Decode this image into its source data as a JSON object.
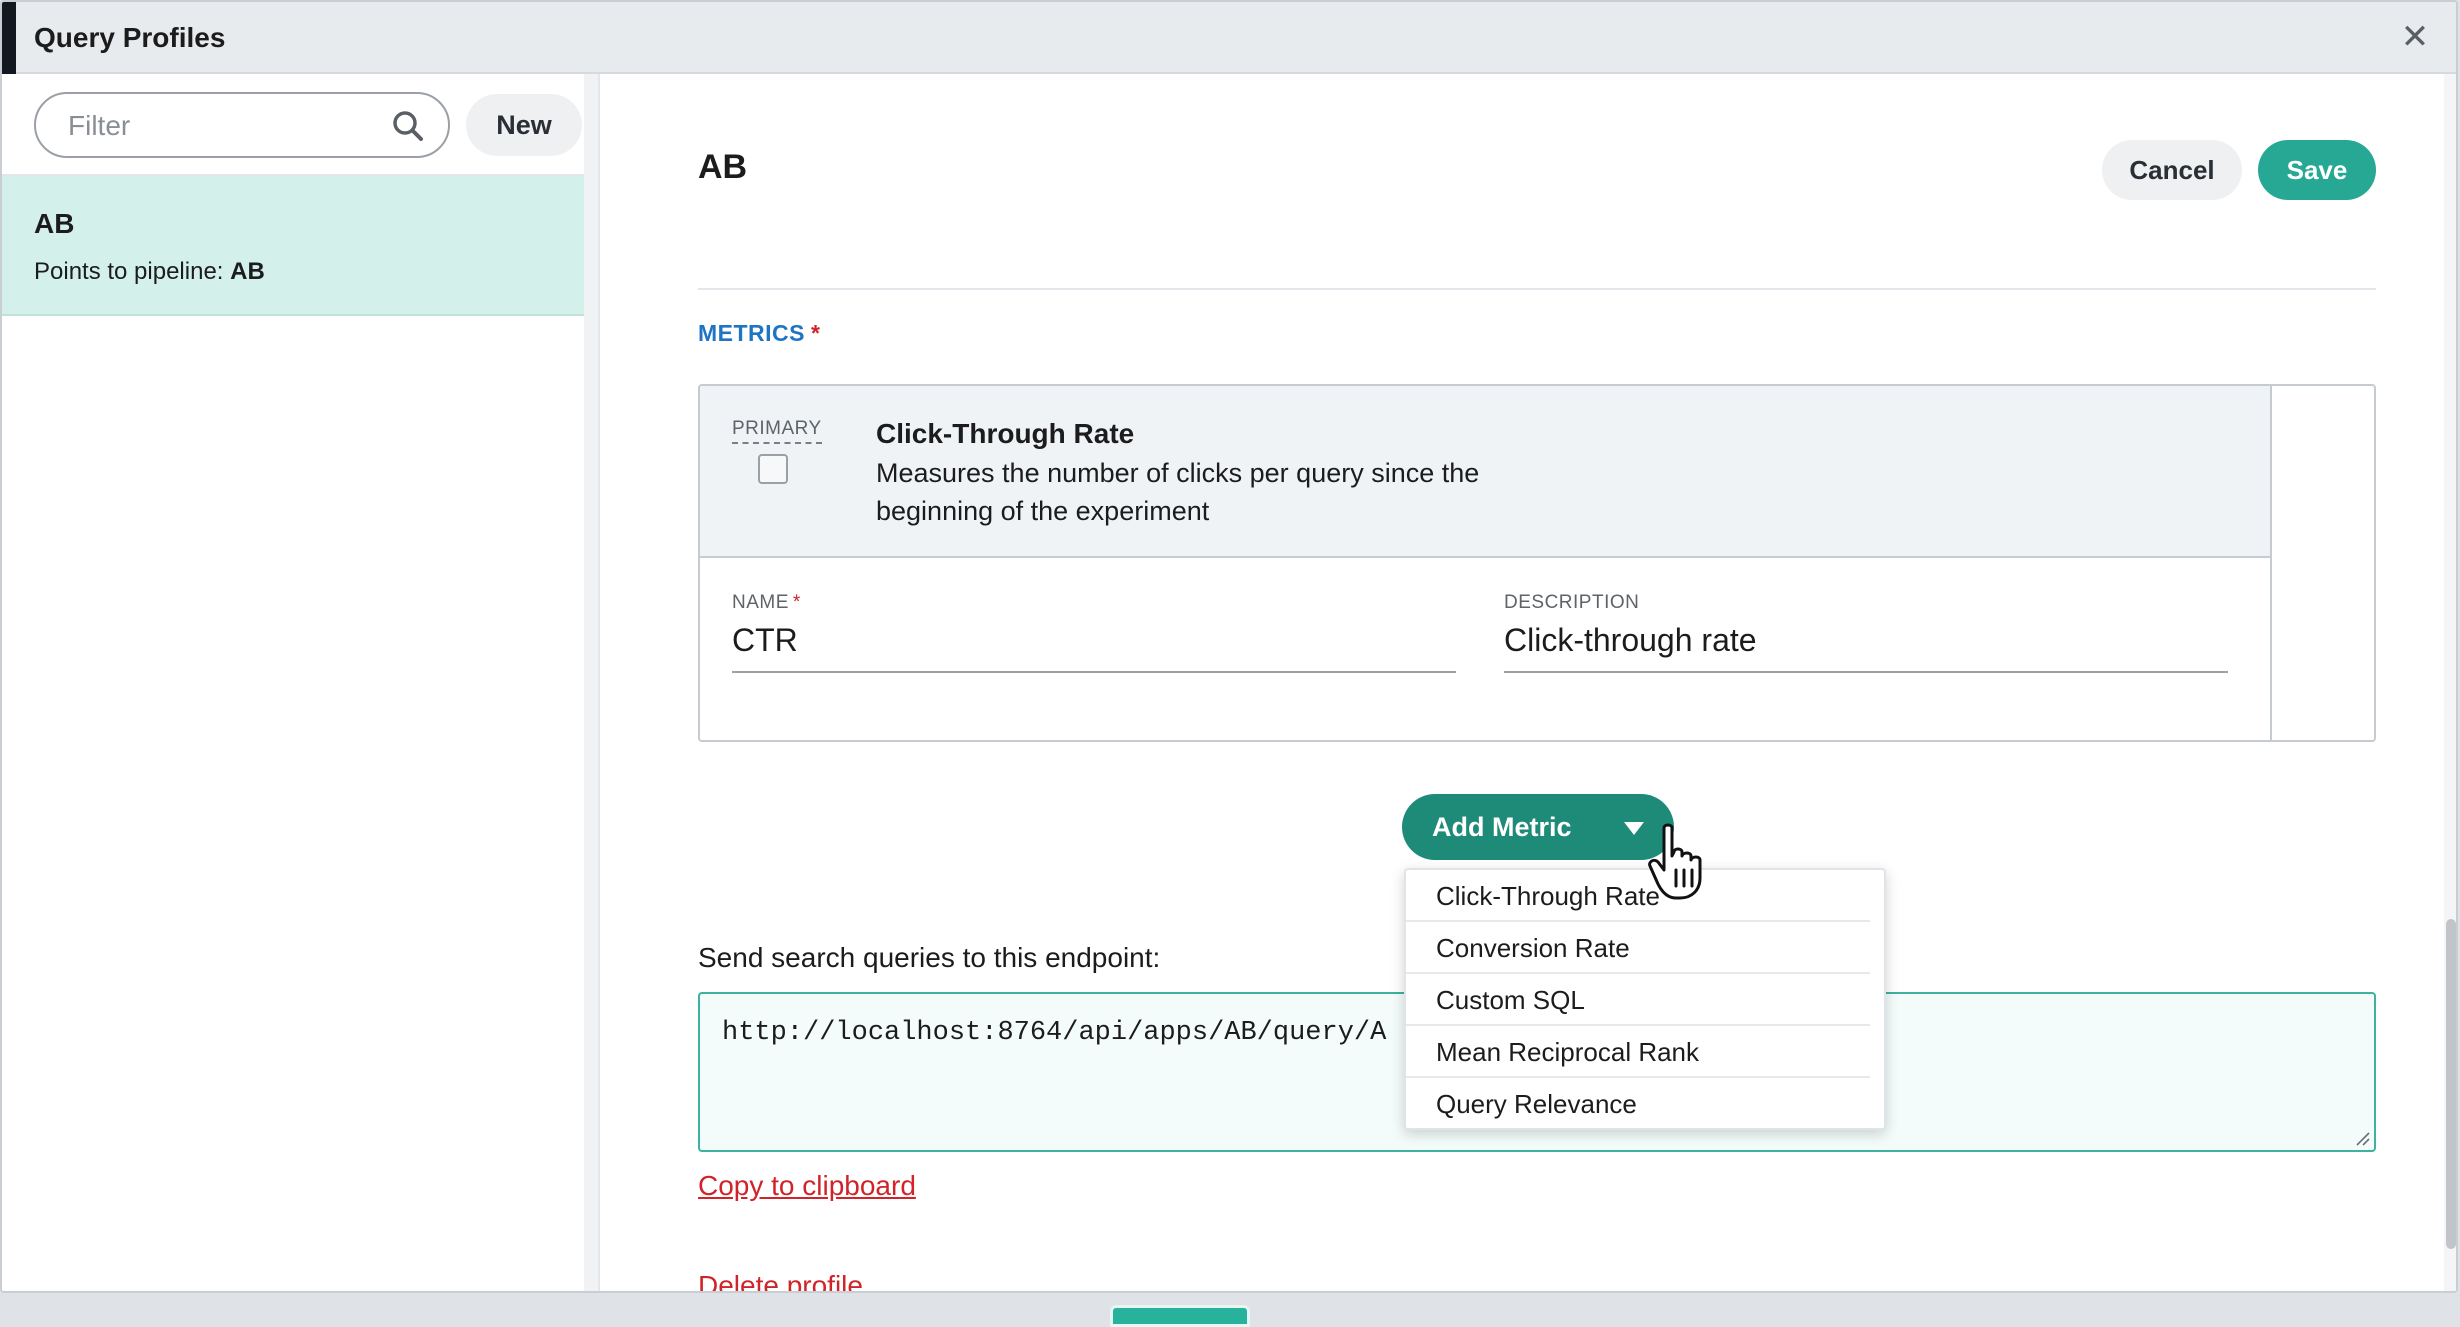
{
  "window": {
    "title": "Query Profiles",
    "close_symbol": "✕"
  },
  "sidebar": {
    "filter_placeholder": "Filter",
    "new_label": "New",
    "profiles": [
      {
        "name": "AB",
        "pipeline_prefix": "Points to pipeline: ",
        "pipeline": "AB"
      }
    ]
  },
  "main": {
    "title": "AB",
    "cancel_label": "Cancel",
    "save_label": "Save",
    "metrics_label": "METRICS",
    "required_mark": "*",
    "metric": {
      "primary_label": "PRIMARY",
      "title": "Click-Through Rate",
      "description": "Measures the number of clicks per query since the beginning of the experiment",
      "name_label": "NAME",
      "name_value": "CTR",
      "description_label": "DESCRIPTION",
      "description_value": "Click-through rate"
    },
    "add_metric_label": "Add Metric",
    "add_metric_options": [
      "Click-Through Rate",
      "Conversion Rate",
      "Custom SQL",
      "Mean Reciprocal Rank",
      "Query Relevance"
    ],
    "endpoint_label": "Send search queries to this endpoint:",
    "endpoint_url": "http://localhost:8764/api/apps/AB/query/A",
    "copy_label": "Copy to clipboard",
    "delete_label": "Delete profile"
  },
  "colors": {
    "accent": "#26a894",
    "link": "#d0242a",
    "section": "#1f74c4",
    "selected_bg": "#d3f1ea"
  }
}
